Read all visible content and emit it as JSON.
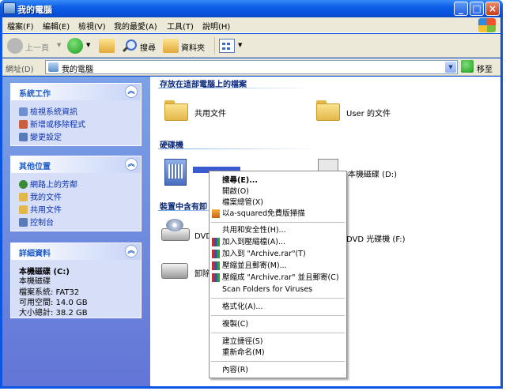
{
  "window": {
    "title": "我的電腦"
  },
  "caption_buttons": {
    "minimize": "_",
    "maximize": "□",
    "close": "×"
  },
  "menubar": [
    "檔案(F)",
    "編輯(E)",
    "檢視(V)",
    "我的最愛(A)",
    "工具(T)",
    "說明(H)"
  ],
  "toolbar": {
    "back": "上一頁",
    "search": "搜尋",
    "folders": "資料夾"
  },
  "address": {
    "label": "網址(D)",
    "value": "我的電腦",
    "go": "移至"
  },
  "left": {
    "system_tasks": {
      "title": "系統工作",
      "links": [
        "檢視系統資訊",
        "新增或移除程式",
        "變更設定"
      ]
    },
    "other_places": {
      "title": "其他位置",
      "links": [
        "網路上的芳鄰",
        "我的文件",
        "共用文件",
        "控制台"
      ]
    },
    "details": {
      "title": "詳細資料",
      "name": "本機磁碟 (C:)",
      "type": "本機磁碟",
      "fs": "檔案系統: FAT32",
      "free": "可用空間: 14.0 GB",
      "total": "大小總計: 38.2 GB"
    }
  },
  "main": {
    "files_group": "存放在這部電腦上的檔案",
    "shared_docs": "共用文件",
    "user_docs": "User 的文件",
    "hdd_group": "硬碟機",
    "local_d": "本機磁碟 (D:)",
    "removable_group": "裝置中含有卸",
    "dvd_e": "DVD",
    "dvd_f": "DVD 光碟機 (F:)",
    "removable_label": "卸除"
  },
  "context_menu": [
    "搜尋(E)...",
    "開啟(O)",
    "檔案總管(X)",
    "以a-squared免費版掃描",
    "共用和安全性(H)...",
    "加入到壓縮檔(A)...",
    "加入到 \"Archive.rar\"(T)",
    "壓縮並且郵寄(M)...",
    "壓縮成 \"Archive.rar\" 並且郵寄(C)",
    "Scan Folders for Viruses",
    "格式化(A)...",
    "複製(C)",
    "建立捷徑(S)",
    "重新命名(M)",
    "內容(R)"
  ]
}
